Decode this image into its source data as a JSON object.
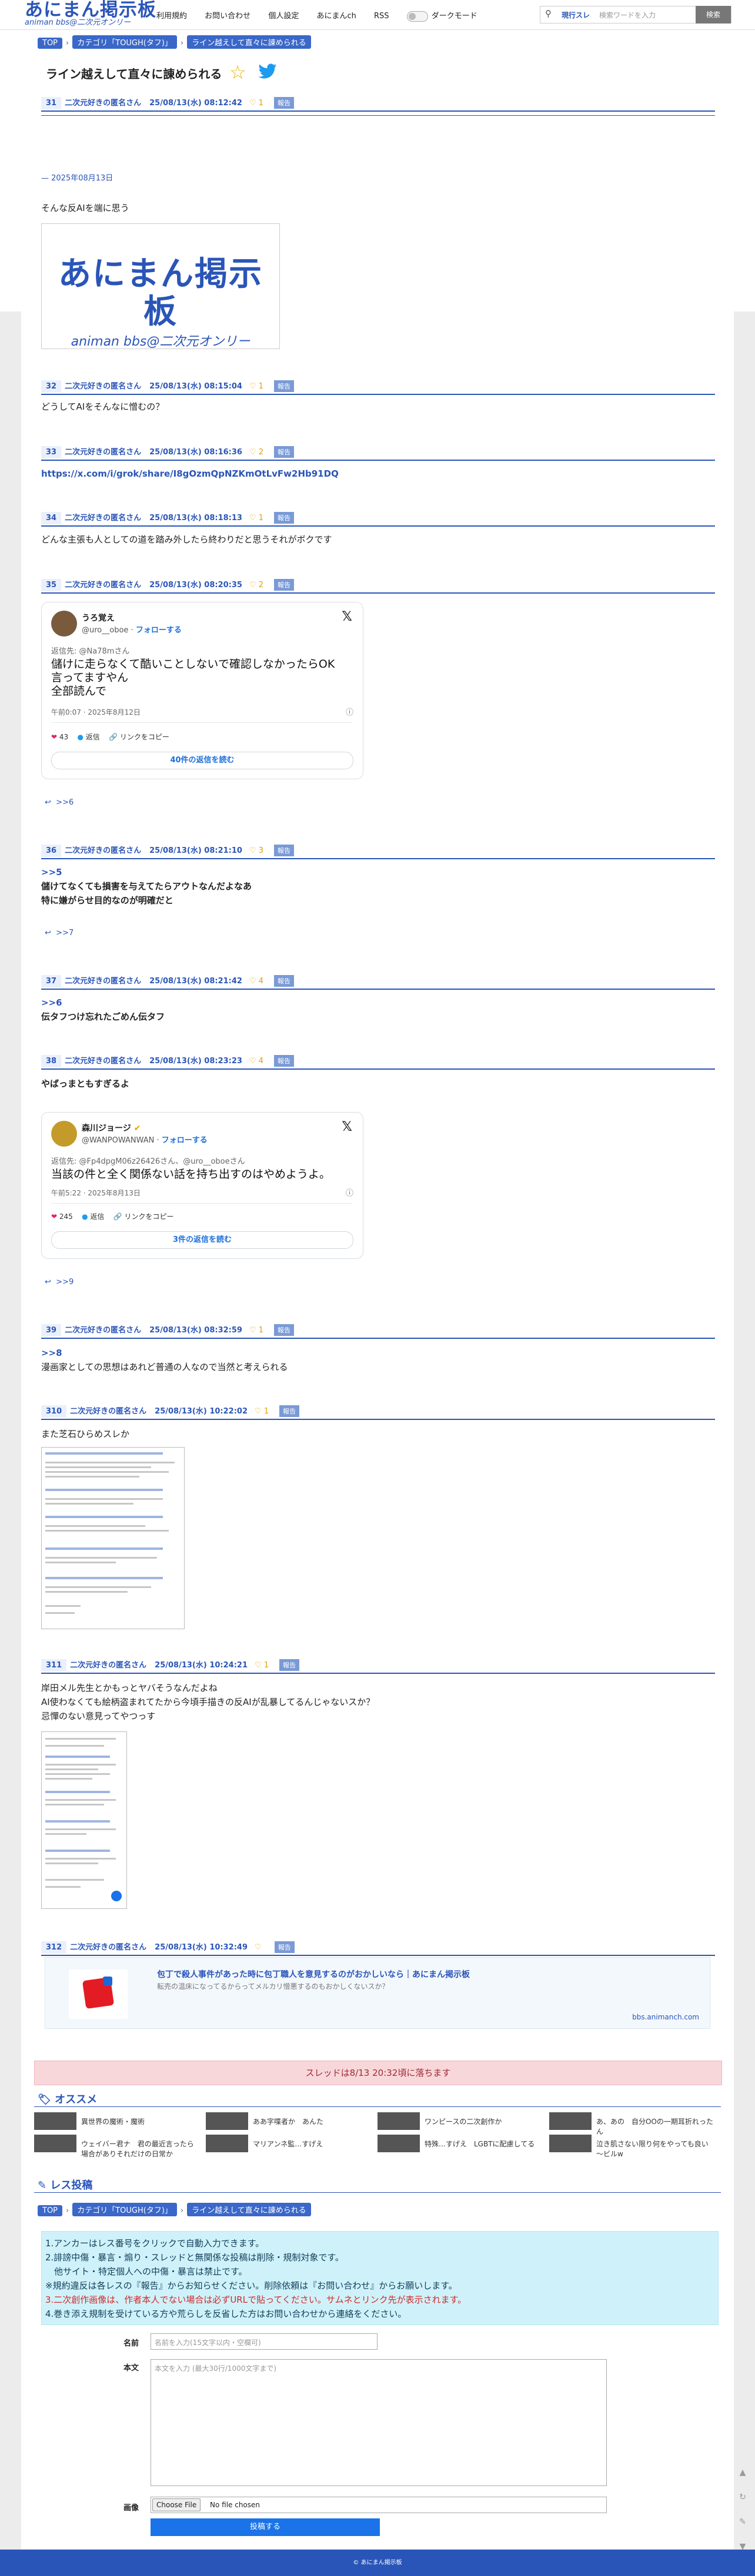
{
  "header": {
    "logo_main": "あにまん掲示板",
    "logo_sub": "animan bbs@二次元オンリー",
    "nav": [
      "利用規約",
      "お問い合わせ",
      "個人設定",
      "あにまんch",
      "RSS"
    ],
    "dark_mode_label": "ダークモード",
    "search_scope": "現行スレ",
    "search_placeholder": "検索ワードを入力",
    "search_button": "検索"
  },
  "breadcrumb": {
    "top": "TOP",
    "category": "カテゴリ「TOUGH(タフ)」",
    "thread": "ライン越えして直々に諌められる",
    "sep": "›"
  },
  "thread_title": "ライン越えして直々に諌められる",
  "posts": [
    {
      "num": "31",
      "name": "二次元好きの匿名さん",
      "date": "25/08/13(水) 08:12:42",
      "likes": "1",
      "report": "報告",
      "date_line": "— 2025年08月13日",
      "text": "そんな反AIを端に思う"
    },
    {
      "num": "32",
      "name": "二次元好きの匿名さん",
      "date": "25/08/13(水) 08:15:04",
      "likes": "1",
      "report": "報告",
      "text": "どうしてAIをそんなに憎むの？"
    },
    {
      "num": "33",
      "name": "二次元好きの匿名さん",
      "date": "25/08/13(水) 08:16:36",
      "likes": "2",
      "report": "報告",
      "text": "https://x.com/i/grok/share/I8gOzmQpNZKmOtLvFw2Hb91DQ"
    },
    {
      "num": "34",
      "name": "二次元好きの匿名さん",
      "date": "25/08/13(水) 08:18:13",
      "likes": "1",
      "report": "報告",
      "text": "どんな主張も人としての道を踏み外したら終わりだと思うそれがボクです"
    },
    {
      "num": "35",
      "name": "二次元好きの匿名さん",
      "date": "25/08/13(水) 08:20:35",
      "likes": "2",
      "report": "報告",
      "anchor": ">>6"
    },
    {
      "num": "36",
      "name": "二次元好きの匿名さん",
      "date": "25/08/13(水) 08:21:10",
      "likes": "3",
      "report": "報告",
      "quote": ">>5",
      "text1": "儲けてなくても損害を与えてたらアウトなんだよなあ",
      "text2": "特に嫌がらせ目的なのが明確だと",
      "anchor": ">>7"
    },
    {
      "num": "37",
      "name": "二次元好きの匿名さん",
      "date": "25/08/13(水) 08:21:42",
      "likes": "4",
      "report": "報告",
      "quote": ">>6",
      "text": "伝タフつけ忘れたごめん伝タフ"
    },
    {
      "num": "38",
      "name": "二次元好きの匿名さん",
      "date": "25/08/13(水) 08:23:23",
      "likes": "4",
      "report": "報告",
      "text": "やばっまともすぎるよ",
      "anchor": ">>9"
    },
    {
      "num": "39",
      "name": "二次元好きの匿名さん",
      "date": "25/08/13(水) 08:32:59",
      "likes": "1",
      "report": "報告",
      "quote": ">>8",
      "text": "漫画家としての思想はあれど普通の人なので当然と考えられる"
    },
    {
      "num": "310",
      "name": "二次元好きの匿名さん",
      "date": "25/08/13(水) 10:22:02",
      "likes": "1",
      "report": "報告",
      "text": "また芝石ひらめスレか"
    },
    {
      "num": "311",
      "name": "二次元好きの匿名さん",
      "date": "25/08/13(水) 10:24:21",
      "likes": "1",
      "report": "報告",
      "text1": "岸田メル先生とかもっとヤバそうなんだよね",
      "text2": "AI使わなくても絵柄盗まれてたから今頃手描きの反AIが乱暴してるんじゃないスか？",
      "text3": "忌憚のない意見ってやつっす"
    },
    {
      "num": "312",
      "name": "二次元好きの匿名さん",
      "date": "25/08/13(水) 10:32:49",
      "likes": "",
      "report": "報告"
    }
  ],
  "logo_image": {
    "main": "あにまん掲示板",
    "sub": "animan bbs@二次元オンリー"
  },
  "tweet1": {
    "name": "うろ覚え",
    "handle": "@uro__oboe",
    "follow": "フォローする",
    "reply_to": "返信先: @Na78mさん",
    "body1": "儲けに走らなくて酷いことしないで確認しなかったらOK",
    "body2": "言ってますやん",
    "body3": "全部読んで",
    "time": "午前0:07 · 2025年8月12日",
    "likes": "43",
    "reply": "返信",
    "copy": "リンクをコピー",
    "more": "40件の返信を読む"
  },
  "tweet2": {
    "name": "森川ジョージ",
    "handle": "@WANPOWANWAN",
    "follow": "フォローする",
    "reply_to": "返信先: @Fp4dpgM06z26426さん、@uro__oboeさん",
    "body": "当該の件と全く関係ない話を持ち出すのはやめようよ。",
    "time": "午前5:22 · 2025年8月13日",
    "likes": "245",
    "reply": "返信",
    "copy": "リンクをコピー",
    "more": "3件の返信を読む"
  },
  "link_card": {
    "title": "包丁で殺人事件があった時に包丁職人を意見するのがおかしいなら｜あにまん掲示板",
    "desc": "転売の温床になってるからってメルカリ憎悪するのもおかしくないスか？",
    "domain": "bbs.animanch.com"
  },
  "alert": "スレッドは8/13 20:32頃に落ちます",
  "recommend": {
    "title": "オススメ",
    "items": [
      "異世界の魔術・魔術",
      "ああ字喋者か　あんた",
      "ワンピースの二次創作か",
      "あ、あの　自分OOの一期耳折れったん",
      "ウェイバー君ナ　君の最近言ったら場合がありそれだけの日常か",
      "マリアンネ監…すげえ",
      "特殊…すげえ　LGBTに配慮してる",
      "泣き肌さない限り何をやっても良い～ビルw"
    ]
  },
  "form": {
    "title": "レス投稿",
    "notice1": "1.アンカーはレス番号をクリックで自動入力できます。",
    "notice2": "2.誹謗中傷・暴言・煽り・スレッドと無関係な投稿は削除・規制対象です。",
    "notice3": "　他サイト・特定個人への中傷・暴言は禁止です。",
    "notice4": "※規約違反は各レスの『報告』からお知らせください。削除依頼は『お問い合わせ』からお願いします。",
    "notice5": "3.二次創作画像は、作者本人でない場合は必ずURLで貼ってください。サムネとリンク先が表示されます。",
    "notice6": "4.巻き添え規制を受けている方や荒らしを反省した方はお問い合わせから連絡をください。",
    "name_label": "名前",
    "name_placeholder": "名前を入力(15文字以内・空欄可)",
    "body_label": "本文",
    "body_placeholder": "本文を入力 (最大30行/1000文字まで)",
    "image_label": "画像",
    "file_button": "Choose File",
    "file_status": "No file chosen",
    "submit": "投稿する"
  },
  "footer": "© あにまん掲示板",
  "colors": {
    "accent": "#2a55b8",
    "alert_bg": "#f8d7da",
    "notice_bg": "#cff2fa",
    "footer": "#2a55b8"
  }
}
